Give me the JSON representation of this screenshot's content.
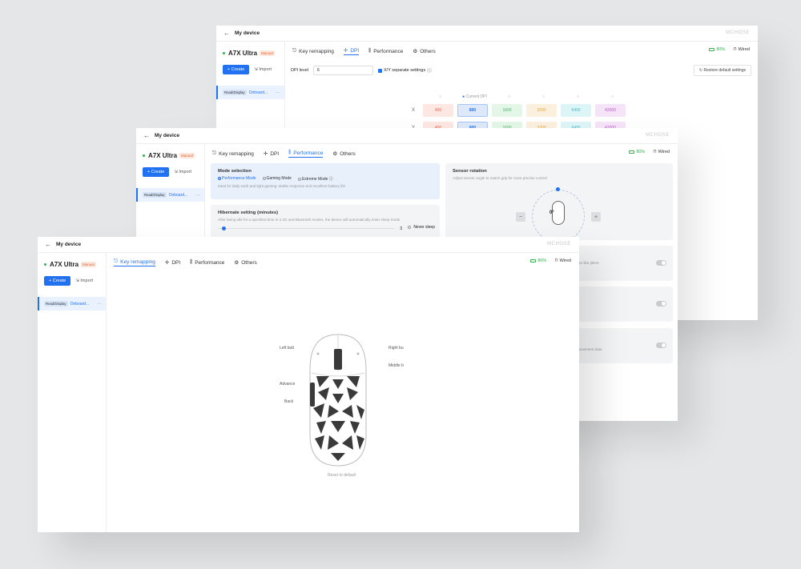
{
  "window_title": "My device",
  "brand": "MCHOSE",
  "device": {
    "name": "A7X Ultra",
    "badge": "Manual"
  },
  "sidebar": {
    "create_label": "Create",
    "import_label": "Import",
    "profile_tag": "Read/Display",
    "profile_name": "Onboard...",
    "more": "···"
  },
  "tabs": {
    "key_remapping": "Key remapping",
    "dpi": "DPI",
    "performance": "Performance",
    "others": "Others"
  },
  "status": {
    "battery": "80%",
    "connection": "Wired"
  },
  "dpi_page": {
    "dpi_level_label": "DPI level",
    "dpi_level_value": "6",
    "xy_label": "X/Y separate settings",
    "restore_label": "Restore default settings",
    "current_dpi_label": "Current DPI",
    "x_label": "X",
    "y_label": "Y",
    "x_values": [
      "400",
      "800",
      "1600",
      "3200",
      "6400",
      "42000"
    ],
    "y_values": [
      "400",
      "800",
      "1600",
      "3200",
      "6400",
      "42000"
    ]
  },
  "performance_page": {
    "mode_title": "Mode selection",
    "modes": [
      "Performance Mode",
      "Gaming Mode",
      "Extreme Mode"
    ],
    "mode_desc": "Ideal for daily work and light gaming: stable response and excellent battery life",
    "hibernate_title": "Hibernate setting (minutes)",
    "hibernate_desc": "After being idle for a specified time in 2.4G and Bluetooth modes, the device will automatically enter sleep mode",
    "hibernate_value": "3",
    "never_sleep": "Never sleep",
    "sensor_title": "Sensor rotation",
    "sensor_desc": "Adjust sensor angle to match grip for more precise control",
    "angle": "0°",
    "minus": "−",
    "plus": "+",
    "setting2_text": "...ose like jitters",
    "setting4_text": "...movement data"
  },
  "key_page": {
    "left_button": "Left butt",
    "right_button": "Right bu",
    "middle_button": "Middle b",
    "advance": "Advance",
    "back": "Back",
    "reset": "Reset to default"
  }
}
